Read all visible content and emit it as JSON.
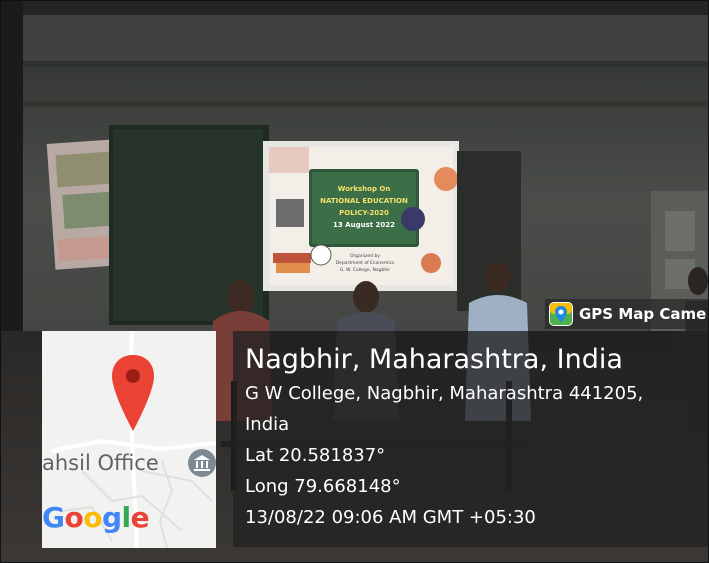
{
  "badge": {
    "label": "GPS Map Came",
    "icon": "map-pin-icon",
    "accent": "#ea4335"
  },
  "location": {
    "place": "Nagbhir, Maharashtra, India",
    "address": "G W College, Nagbhir, Maharashtra 441205,",
    "country": "India",
    "lat": "Lat 20.581837°",
    "long": "Long 79.668148°",
    "datetime": "13/08/22 09:06 AM GMT +05:30"
  },
  "map": {
    "label": "ahsil Office",
    "logo": [
      "G",
      "o",
      "o",
      "g",
      "l",
      "e"
    ],
    "marker_icon": "map-marker-icon",
    "poi_icon": "bank-icon"
  },
  "slide": {
    "line1": "Workshop On",
    "line2": "NATIONAL EDUCATION",
    "line3": "POLICY-2020",
    "line4": "13 August 2022",
    "org1": "Organized by",
    "org2": "Department of Economics",
    "org3": "G. W. College, Nagbhir"
  }
}
